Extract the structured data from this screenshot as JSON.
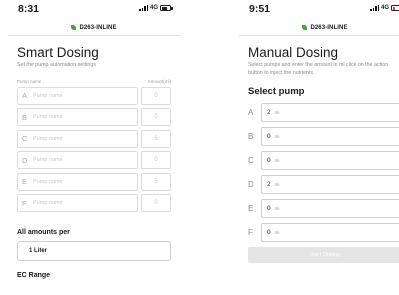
{
  "colors": {
    "leaf": "#3fa34d",
    "battery_left": "#222222",
    "battery_right": "#e53935"
  },
  "smart_dosing": {
    "status": {
      "time": "8:31",
      "network": "4G"
    },
    "device_name": "D263-INLINE",
    "title": "Smart Dosing",
    "subtitle": "Set the pump automation settings",
    "col_pump": "Pump name",
    "col_amount": "Amount(ml)",
    "pumps": [
      {
        "letter": "A",
        "placeholder": "Pump name",
        "amount": "0"
      },
      {
        "letter": "B",
        "placeholder": "Pump name",
        "amount": "0"
      },
      {
        "letter": "C",
        "placeholder": "Pump name",
        "amount": "5"
      },
      {
        "letter": "D",
        "placeholder": "Pump name",
        "amount": "0"
      },
      {
        "letter": "E",
        "placeholder": "Pump name",
        "amount": "5"
      },
      {
        "letter": "F",
        "placeholder": "Pump name",
        "amount": "0"
      }
    ],
    "all_amounts_label": "All amounts per",
    "all_amounts_value": "1 Liter",
    "ec_range_label": "EC Range"
  },
  "manual_dosing": {
    "status": {
      "time": "9:51",
      "network": "4G"
    },
    "device_name": "D263-INLINE",
    "title": "Manual Dosing",
    "subtitle": "Select pumps and enter the amount in ml click on the action button to inject the nutrients.",
    "select_pump_label": "Select pump",
    "unit": "ml",
    "pumps": [
      {
        "letter": "A",
        "value": "2"
      },
      {
        "letter": "B",
        "value": "0"
      },
      {
        "letter": "C",
        "value": "0"
      },
      {
        "letter": "D",
        "value": "2"
      },
      {
        "letter": "E",
        "value": "0"
      },
      {
        "letter": "F",
        "value": "0"
      }
    ],
    "start_button": "Start Dosing"
  }
}
